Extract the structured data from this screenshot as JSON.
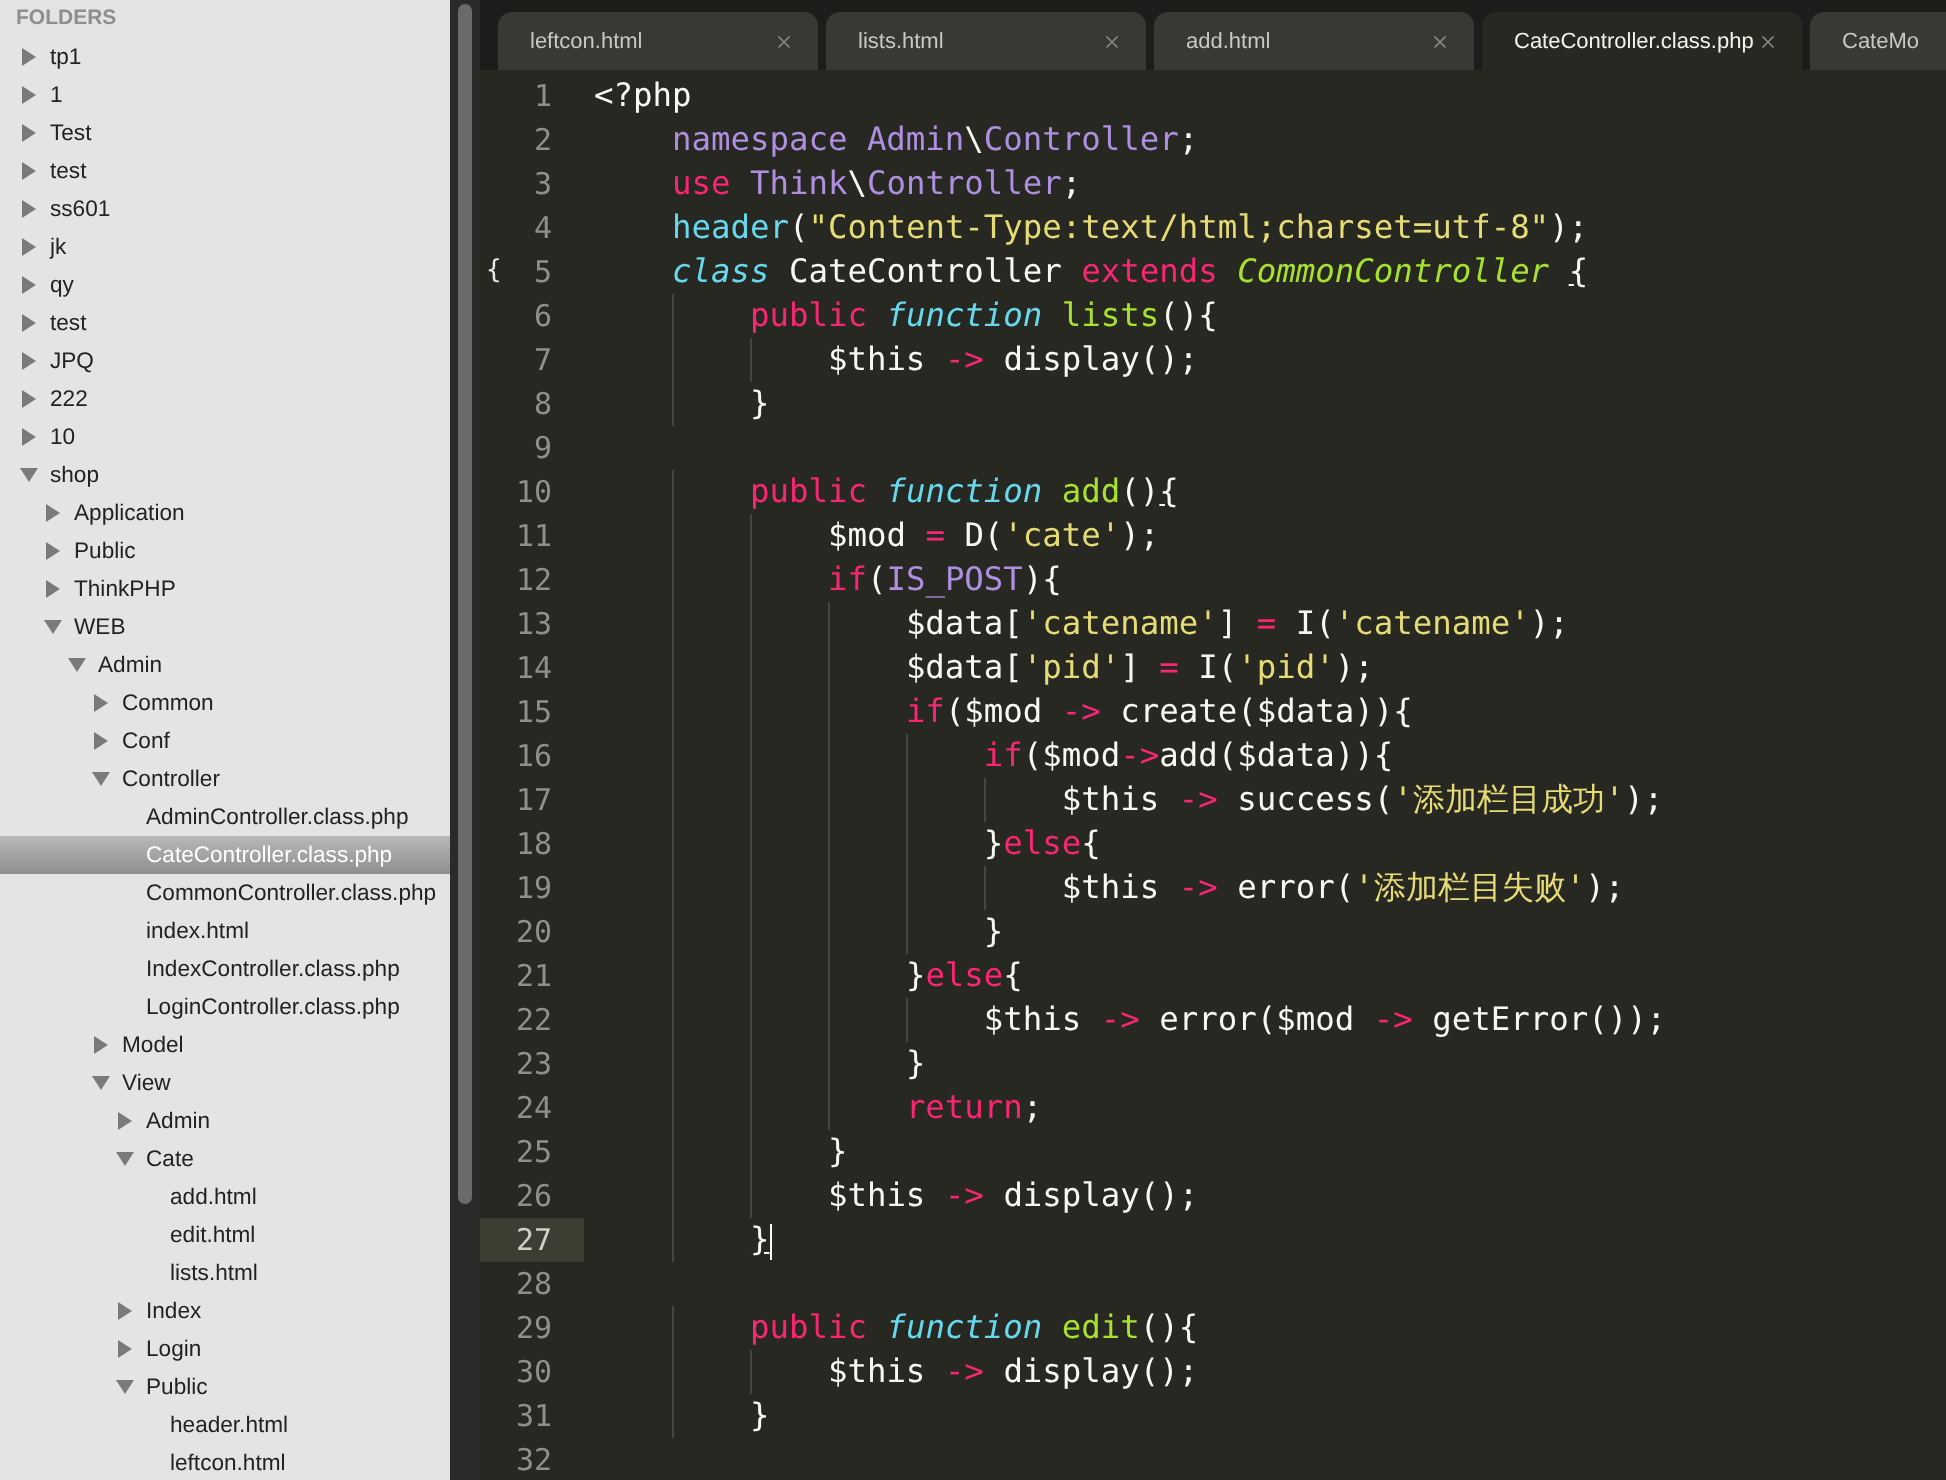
{
  "sidebar": {
    "title": "FOLDERS",
    "items": [
      {
        "label": "tp1",
        "kind": "folder",
        "expanded": false,
        "selected": false
      },
      {
        "label": "1",
        "kind": "folder",
        "expanded": false,
        "selected": false
      },
      {
        "label": "Test",
        "kind": "folder",
        "expanded": false,
        "selected": false
      },
      {
        "label": "test",
        "kind": "folder",
        "expanded": false,
        "selected": false
      },
      {
        "label": "ss601",
        "kind": "folder",
        "expanded": false,
        "selected": false
      },
      {
        "label": "jk",
        "kind": "folder",
        "expanded": false,
        "selected": false
      },
      {
        "label": "qy",
        "kind": "folder",
        "expanded": false,
        "selected": false
      },
      {
        "label": "test",
        "kind": "folder",
        "expanded": false,
        "selected": false
      },
      {
        "label": "JPQ",
        "kind": "folder",
        "expanded": false,
        "selected": false
      },
      {
        "label": "222",
        "kind": "folder",
        "expanded": false,
        "selected": false
      },
      {
        "label": "10",
        "kind": "folder",
        "expanded": false,
        "selected": false
      },
      {
        "label": "shop",
        "kind": "folder",
        "expanded": true,
        "selected": false,
        "children": [
          {
            "label": "Application",
            "kind": "folder",
            "expanded": false,
            "selected": false
          },
          {
            "label": "Public",
            "kind": "folder",
            "expanded": false,
            "selected": false
          },
          {
            "label": "ThinkPHP",
            "kind": "folder",
            "expanded": false,
            "selected": false
          },
          {
            "label": "WEB",
            "kind": "folder",
            "expanded": true,
            "selected": false,
            "children": [
              {
                "label": "Admin",
                "kind": "folder",
                "expanded": true,
                "selected": false,
                "children": [
                  {
                    "label": "Common",
                    "kind": "folder",
                    "expanded": false,
                    "selected": false
                  },
                  {
                    "label": "Conf",
                    "kind": "folder",
                    "expanded": false,
                    "selected": false
                  },
                  {
                    "label": "Controller",
                    "kind": "folder",
                    "expanded": true,
                    "selected": false,
                    "children": [
                      {
                        "label": "AdminController.class.php",
                        "kind": "file",
                        "selected": false
                      },
                      {
                        "label": "CateController.class.php",
                        "kind": "file",
                        "selected": true
                      },
                      {
                        "label": "CommonController.class.php",
                        "kind": "file",
                        "selected": false
                      },
                      {
                        "label": "index.html",
                        "kind": "file",
                        "selected": false
                      },
                      {
                        "label": "IndexController.class.php",
                        "kind": "file",
                        "selected": false
                      },
                      {
                        "label": "LoginController.class.php",
                        "kind": "file",
                        "selected": false
                      }
                    ]
                  },
                  {
                    "label": "Model",
                    "kind": "folder",
                    "expanded": false,
                    "selected": false
                  },
                  {
                    "label": "View",
                    "kind": "folder",
                    "expanded": true,
                    "selected": false,
                    "children": [
                      {
                        "label": "Admin",
                        "kind": "folder",
                        "expanded": false,
                        "selected": false
                      },
                      {
                        "label": "Cate",
                        "kind": "folder",
                        "expanded": true,
                        "selected": false,
                        "children": [
                          {
                            "label": "add.html",
                            "kind": "file",
                            "selected": false
                          },
                          {
                            "label": "edit.html",
                            "kind": "file",
                            "selected": false
                          },
                          {
                            "label": "lists.html",
                            "kind": "file",
                            "selected": false
                          }
                        ]
                      },
                      {
                        "label": "Index",
                        "kind": "folder",
                        "expanded": false,
                        "selected": false
                      },
                      {
                        "label": "Login",
                        "kind": "folder",
                        "expanded": false,
                        "selected": false
                      },
                      {
                        "label": "Public",
                        "kind": "folder",
                        "expanded": true,
                        "selected": false,
                        "children": [
                          {
                            "label": "header.html",
                            "kind": "file",
                            "selected": false
                          },
                          {
                            "label": "leftcon.html",
                            "kind": "file",
                            "selected": false
                          }
                        ]
                      }
                    ]
                  }
                ]
              }
            ]
          }
        ]
      }
    ]
  },
  "tabs": [
    {
      "label": "leftcon.html",
      "selected": false
    },
    {
      "label": "lists.html",
      "selected": false
    },
    {
      "label": "add.html",
      "selected": false
    },
    {
      "label": "CateController.class.php",
      "selected": true
    },
    {
      "label": "CateMo",
      "selected": false
    }
  ],
  "editor": {
    "lines": [
      {
        "number": "1",
        "current": false,
        "tokens": [
          {
            "text": "<?php",
            "kind": "plain"
          }
        ]
      },
      {
        "number": "2",
        "current": false,
        "tokens": [
          {
            "text": "    namespace Admin",
            "kind": "ns"
          },
          {
            "text": "\\",
            "kind": "plain"
          },
          {
            "text": "Controller",
            "kind": "ns"
          },
          {
            "text": ";",
            "kind": "plain"
          }
        ]
      },
      {
        "number": "3",
        "current": false,
        "tokens": [
          {
            "text": "    use ",
            "kind": "kw"
          },
          {
            "text": "Think",
            "kind": "ns"
          },
          {
            "text": "\\",
            "kind": "plain"
          },
          {
            "text": "Controller",
            "kind": "ns"
          },
          {
            "text": ";",
            "kind": "plain"
          }
        ]
      },
      {
        "number": "4",
        "current": false,
        "tokens": [
          {
            "text": "    header",
            "kind": "support"
          },
          {
            "text": "(",
            "kind": "plain"
          },
          {
            "text": "\"Content-Type:text/html;charset=utf-8\"",
            "kind": "str"
          },
          {
            "text": ");",
            "kind": "plain"
          }
        ]
      },
      {
        "number": "5",
        "current": false,
        "fold": "{",
        "tokens": [
          {
            "text": "    class",
            "kind": "storage"
          },
          {
            "text": " CateController ",
            "kind": "plain"
          },
          {
            "text": "extends ",
            "kind": "kw"
          },
          {
            "text": "CommonController ",
            "kind": "inherit"
          },
          {
            "text": "{",
            "kind": "plain",
            "matched": true
          }
        ]
      },
      {
        "number": "6",
        "current": false,
        "tokens": [
          {
            "text": "        public ",
            "kind": "kw"
          },
          {
            "text": "function ",
            "kind": "storage"
          },
          {
            "text": "lists",
            "kind": "fn"
          },
          {
            "text": "(){",
            "kind": "plain"
          }
        ]
      },
      {
        "number": "7",
        "current": false,
        "tokens": [
          {
            "text": "            $this ",
            "kind": "plain"
          },
          {
            "text": "->",
            "kind": "kw"
          },
          {
            "text": " display();",
            "kind": "plain"
          }
        ]
      },
      {
        "number": "8",
        "current": false,
        "tokens": [
          {
            "text": "        }",
            "kind": "plain"
          }
        ]
      },
      {
        "number": "9",
        "current": false
      },
      {
        "number": "10",
        "current": false,
        "tokens": [
          {
            "text": "        public ",
            "kind": "kw"
          },
          {
            "text": "function ",
            "kind": "storage"
          },
          {
            "text": "add",
            "kind": "fn"
          },
          {
            "text": "()",
            "kind": "plain"
          },
          {
            "text": "{",
            "kind": "plain",
            "matched": true
          }
        ]
      },
      {
        "number": "11",
        "current": false,
        "tokens": [
          {
            "text": "            $mod ",
            "kind": "plain"
          },
          {
            "text": "=",
            "kind": "kw"
          },
          {
            "text": " D(",
            "kind": "plain"
          },
          {
            "text": "'cate'",
            "kind": "str"
          },
          {
            "text": ");",
            "kind": "plain"
          }
        ]
      },
      {
        "number": "12",
        "current": false,
        "tokens": [
          {
            "text": "            if",
            "kind": "kw"
          },
          {
            "text": "(",
            "kind": "plain"
          },
          {
            "text": "IS_POST",
            "kind": "ns"
          },
          {
            "text": "){",
            "kind": "plain"
          }
        ]
      },
      {
        "number": "13",
        "current": false,
        "tokens": [
          {
            "text": "                $data[",
            "kind": "plain"
          },
          {
            "text": "'catename'",
            "kind": "str"
          },
          {
            "text": "] ",
            "kind": "plain"
          },
          {
            "text": "=",
            "kind": "kw"
          },
          {
            "text": " I(",
            "kind": "plain"
          },
          {
            "text": "'catename'",
            "kind": "str"
          },
          {
            "text": ");",
            "kind": "plain"
          }
        ]
      },
      {
        "number": "14",
        "current": false,
        "tokens": [
          {
            "text": "                $data[",
            "kind": "plain"
          },
          {
            "text": "'pid'",
            "kind": "str"
          },
          {
            "text": "] ",
            "kind": "plain"
          },
          {
            "text": "=",
            "kind": "kw"
          },
          {
            "text": " I(",
            "kind": "plain"
          },
          {
            "text": "'pid'",
            "kind": "str"
          },
          {
            "text": ");",
            "kind": "plain"
          }
        ]
      },
      {
        "number": "15",
        "current": false,
        "tokens": [
          {
            "text": "                if",
            "kind": "kw"
          },
          {
            "text": "($mod ",
            "kind": "plain"
          },
          {
            "text": "->",
            "kind": "kw"
          },
          {
            "text": " create($data)){",
            "kind": "plain"
          }
        ]
      },
      {
        "number": "16",
        "current": false,
        "tokens": [
          {
            "text": "                    if",
            "kind": "kw"
          },
          {
            "text": "($mod",
            "kind": "plain"
          },
          {
            "text": "->",
            "kind": "kw"
          },
          {
            "text": "add($data)){",
            "kind": "plain"
          }
        ]
      },
      {
        "number": "17",
        "current": false,
        "tokens": [
          {
            "text": "                        $this ",
            "kind": "plain"
          },
          {
            "text": "->",
            "kind": "kw"
          },
          {
            "text": " success(",
            "kind": "plain"
          },
          {
            "text": "'添加栏目成功'",
            "kind": "str"
          },
          {
            "text": ");",
            "kind": "plain"
          }
        ]
      },
      {
        "number": "18",
        "current": false,
        "tokens": [
          {
            "text": "                    }",
            "kind": "plain"
          },
          {
            "text": "else",
            "kind": "kw"
          },
          {
            "text": "{",
            "kind": "plain"
          }
        ]
      },
      {
        "number": "19",
        "current": false,
        "tokens": [
          {
            "text": "                        $this ",
            "kind": "plain"
          },
          {
            "text": "->",
            "kind": "kw"
          },
          {
            "text": " error(",
            "kind": "plain"
          },
          {
            "text": "'添加栏目失败'",
            "kind": "str"
          },
          {
            "text": ");",
            "kind": "plain"
          }
        ]
      },
      {
        "number": "20",
        "current": false,
        "tokens": [
          {
            "text": "                    }",
            "kind": "plain"
          }
        ]
      },
      {
        "number": "21",
        "current": false,
        "tokens": [
          {
            "text": "                }",
            "kind": "plain"
          },
          {
            "text": "else",
            "kind": "kw"
          },
          {
            "text": "{",
            "kind": "plain"
          }
        ]
      },
      {
        "number": "22",
        "current": false,
        "tokens": [
          {
            "text": "                    $this ",
            "kind": "plain"
          },
          {
            "text": "->",
            "kind": "kw"
          },
          {
            "text": " error($mod ",
            "kind": "plain"
          },
          {
            "text": "->",
            "kind": "kw"
          },
          {
            "text": " getError());",
            "kind": "plain"
          }
        ]
      },
      {
        "number": "23",
        "current": false,
        "tokens": [
          {
            "text": "                }",
            "kind": "plain"
          }
        ]
      },
      {
        "number": "24",
        "current": false,
        "tokens": [
          {
            "text": "                return",
            "kind": "kw"
          },
          {
            "text": ";",
            "kind": "plain"
          }
        ]
      },
      {
        "number": "25",
        "current": false,
        "tokens": [
          {
            "text": "            }",
            "kind": "plain"
          }
        ]
      },
      {
        "number": "26",
        "current": false,
        "tokens": [
          {
            "text": "            $this ",
            "kind": "plain"
          },
          {
            "text": "->",
            "kind": "kw"
          },
          {
            "text": " display();",
            "kind": "plain"
          }
        ]
      },
      {
        "number": "27",
        "current": true,
        "tokens": [
          {
            "text": "        }",
            "kind": "plain",
            "matched": true
          }
        ]
      },
      {
        "number": "28",
        "current": false
      },
      {
        "number": "29",
        "current": false,
        "tokens": [
          {
            "text": "        public ",
            "kind": "kw"
          },
          {
            "text": "function ",
            "kind": "storage"
          },
          {
            "text": "edit",
            "kind": "fn"
          },
          {
            "text": "(){",
            "kind": "plain"
          }
        ]
      },
      {
        "number": "30",
        "current": false,
        "tokens": [
          {
            "text": "            $this ",
            "kind": "plain"
          },
          {
            "text": "->",
            "kind": "kw"
          },
          {
            "text": " display();",
            "kind": "plain"
          }
        ]
      },
      {
        "number": "31",
        "current": false,
        "tokens": [
          {
            "text": "        }",
            "kind": "plain"
          }
        ]
      },
      {
        "number": "32",
        "current": false
      }
    ]
  }
}
